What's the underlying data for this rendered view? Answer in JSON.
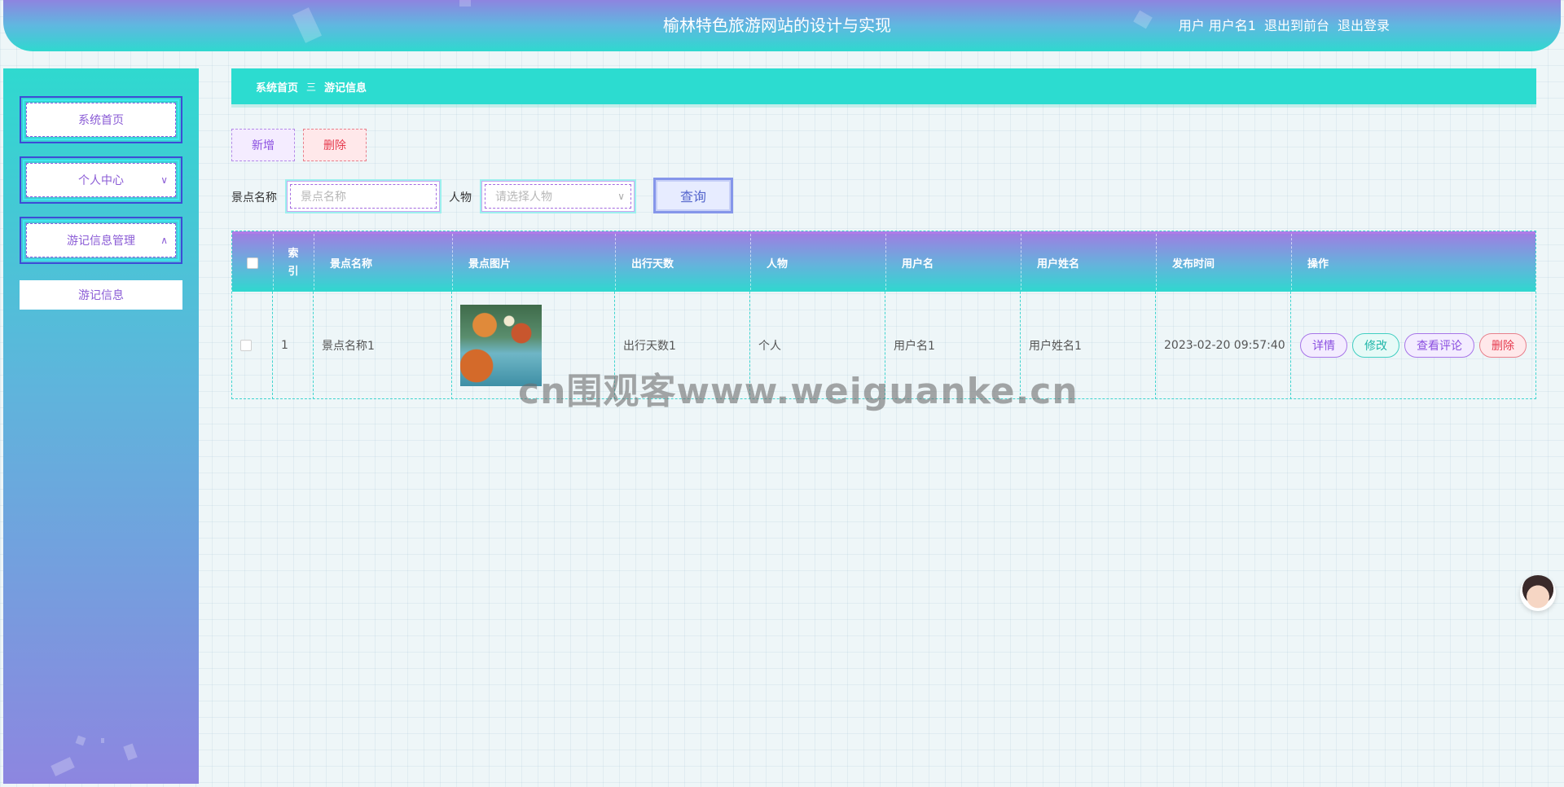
{
  "header": {
    "title": "榆林特色旅游网站的设计与实现",
    "user_label": "用户 用户名1",
    "to_front_label": "退出到前台",
    "logout_label": "退出登录"
  },
  "sidebar": {
    "items": [
      {
        "label": "系统首页"
      },
      {
        "label": "个人中心"
      },
      {
        "label": "游记信息管理"
      }
    ],
    "submenu": [
      {
        "label": "游记信息"
      }
    ]
  },
  "breadcrumb": {
    "home": "系统首页",
    "separator": "三",
    "current": "游记信息"
  },
  "toolbar": {
    "add_label": "新增",
    "delete_label": "删除"
  },
  "search": {
    "name_label": "景点名称",
    "name_placeholder": "景点名称",
    "person_label": "人物",
    "person_placeholder": "请选择人物",
    "query_label": "查询"
  },
  "table": {
    "headers": [
      "索引",
      "景点名称",
      "景点图片",
      "出行天数",
      "人物",
      "用户名",
      "用户姓名",
      "发布时间",
      "操作"
    ],
    "rows": [
      {
        "index": "1",
        "name": "景点名称1",
        "days": "出行天数1",
        "person": "个人",
        "username": "用户名1",
        "realname": "用户姓名1",
        "time": "2023-02-20 09:57:40"
      }
    ],
    "actions": {
      "detail": "详情",
      "edit": "修改",
      "comment": "查看评论",
      "delete": "删除"
    }
  },
  "watermark": "cn围观客www.weiguanke.cn",
  "colors": {
    "accent_cyan": "#2cdcd0",
    "accent_purple": "#8b5cd6",
    "danger": "#e63a4e"
  }
}
